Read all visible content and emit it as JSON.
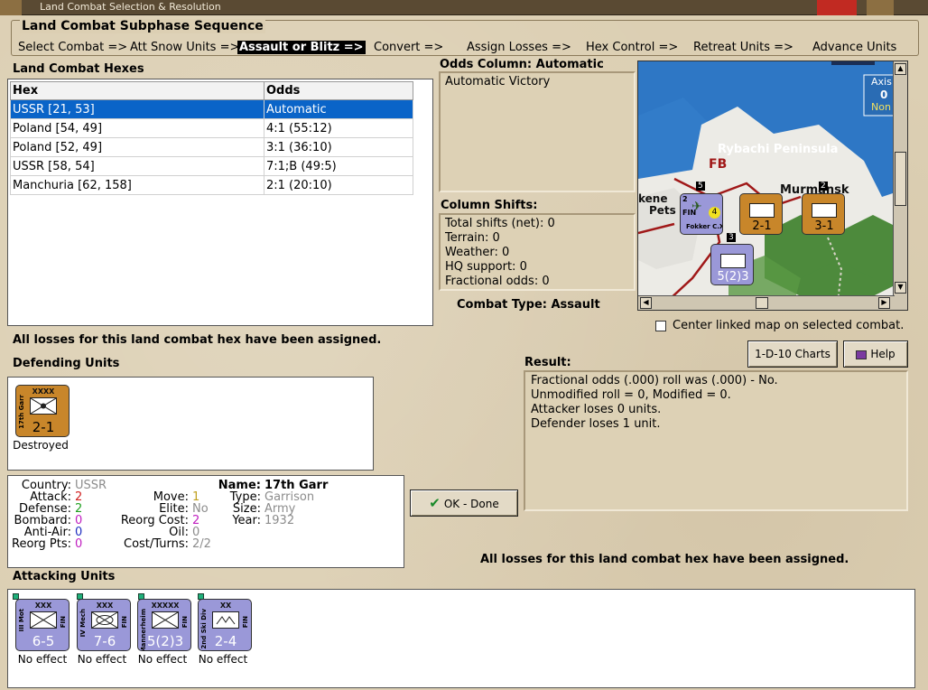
{
  "window": {
    "title": "Land Combat Selection & Resolution"
  },
  "sequence": {
    "title": "Land Combat Subphase Sequence",
    "steps": [
      {
        "label": "Select Combat =>"
      },
      {
        "label": "Att Snow Units =>"
      },
      {
        "label": "Assault or Blitz =>",
        "active": true
      },
      {
        "label": "Convert =>"
      },
      {
        "label": "Assign Losses =>"
      },
      {
        "label": "Hex Control =>"
      },
      {
        "label": "Retreat Units =>"
      },
      {
        "label": "Advance Units"
      }
    ]
  },
  "hexes": {
    "title": "Land Combat Hexes",
    "columns": [
      "Hex",
      "Odds"
    ],
    "rows": [
      {
        "hex": "USSR [21, 53]",
        "odds": "Automatic",
        "selected": true
      },
      {
        "hex": "Poland [54, 49]",
        "odds": "4:1 (55:12)"
      },
      {
        "hex": "Poland [52, 49]",
        "odds": "3:1 (36:10)"
      },
      {
        "hex": "USSR [58, 54]",
        "odds": "7:1;B (49:5)"
      },
      {
        "hex": "Manchuria [62, 158]",
        "odds": "2:1 (20:10)"
      }
    ]
  },
  "odds": {
    "title": "Odds Column: Automatic",
    "value": "Automatic Victory"
  },
  "shifts": {
    "title": "Column Shifts:",
    "lines": [
      "Total shifts (net): 0",
      "Terrain: 0",
      "Weather: 0",
      "HQ support: 0",
      "Fractional odds: 0"
    ]
  },
  "combat_type": "Combat Type:  Assault",
  "map": {
    "region_label": "Rybachi Peninsula",
    "town_label": "Murmansk",
    "fb_label": "FB",
    "pets_label": "Pets",
    "kene_label": "kene",
    "axis_label": "Axis",
    "axis_value": "0",
    "non_label": "Non",
    "stack_5": "5",
    "stack_3": "3",
    "stack_2": "2",
    "air_unit": "Fokker C.X",
    "air_nat": "FIN",
    "air_value": "4",
    "air_size": "2",
    "unit1": "2-1",
    "unit2": "3-1",
    "unit3": "5(2)3"
  },
  "center_map_checkbox": {
    "label": "Center linked map on selected combat.",
    "checked": false
  },
  "buttons": {
    "charts": "1-D-10 Charts",
    "help": "Help",
    "ok": "OK - Done"
  },
  "losses_note_left": "All losses for this land combat hex have been assigned.",
  "losses_note_bottom": "All losses for this land combat hex have been assigned.",
  "defending": {
    "title": "Defending Units",
    "units": [
      {
        "name": "17th Garr",
        "size": "XXXX",
        "value": "2-1",
        "status": "Destroyed"
      }
    ]
  },
  "unit_info": {
    "country_label": "Country:",
    "country": "USSR",
    "attack_label": "Attack:",
    "attack": "2",
    "defense_label": "Defense:",
    "defense": "2",
    "bombard_label": "Bombard:",
    "bombard": "0",
    "antiair_label": "Anti-Air:",
    "antiair": "0",
    "reorg_pts_label": "Reorg Pts:",
    "reorg_pts": "0",
    "move_label": "Move:",
    "move": "1",
    "elite_label": "Elite:",
    "elite": "No",
    "reorg_cost_label": "Reorg Cost:",
    "reorg_cost": "2",
    "oil_label": "Oil:",
    "oil": "0",
    "cost_turns_label": "Cost/Turns:",
    "cost_turns": "2/2",
    "name_label": "Name:",
    "name": "17th Garr",
    "type_label": "Type:",
    "type": "Garrison",
    "size_label": "Size:",
    "size": "Army",
    "year_label": "Year:",
    "year": "1932"
  },
  "result": {
    "title": "Result:",
    "lines": [
      "Fractional odds (.000) roll was (.000)  - No.",
      "Unmodified roll = 0, Modified = 0.",
      "Attacker loses 0 units.",
      "Defender loses 1 unit."
    ]
  },
  "attacking": {
    "title": "Attacking Units",
    "units": [
      {
        "name": "III Mot",
        "size": "XXX",
        "value": "6-5",
        "nat": "FIN",
        "status": "No effect"
      },
      {
        "name": "IV Mech",
        "size": "XXX",
        "value": "7-6",
        "nat": "FIN",
        "status": "No effect"
      },
      {
        "name": "Mannerheim",
        "size": "XXXXX",
        "value": "5(2)3",
        "nat": "FIN",
        "status": "No effect"
      },
      {
        "name": "2nd Ski Div",
        "size": "XX",
        "value": "2-4",
        "nat": "FIN",
        "status": "No effect"
      }
    ]
  },
  "colors": {
    "finnish_counter": "#9a98d8",
    "soviet_counter": "#c8862a",
    "selection": "#0a64c8",
    "title_bar": "#5a4a33",
    "close_button": "#c12a22"
  }
}
